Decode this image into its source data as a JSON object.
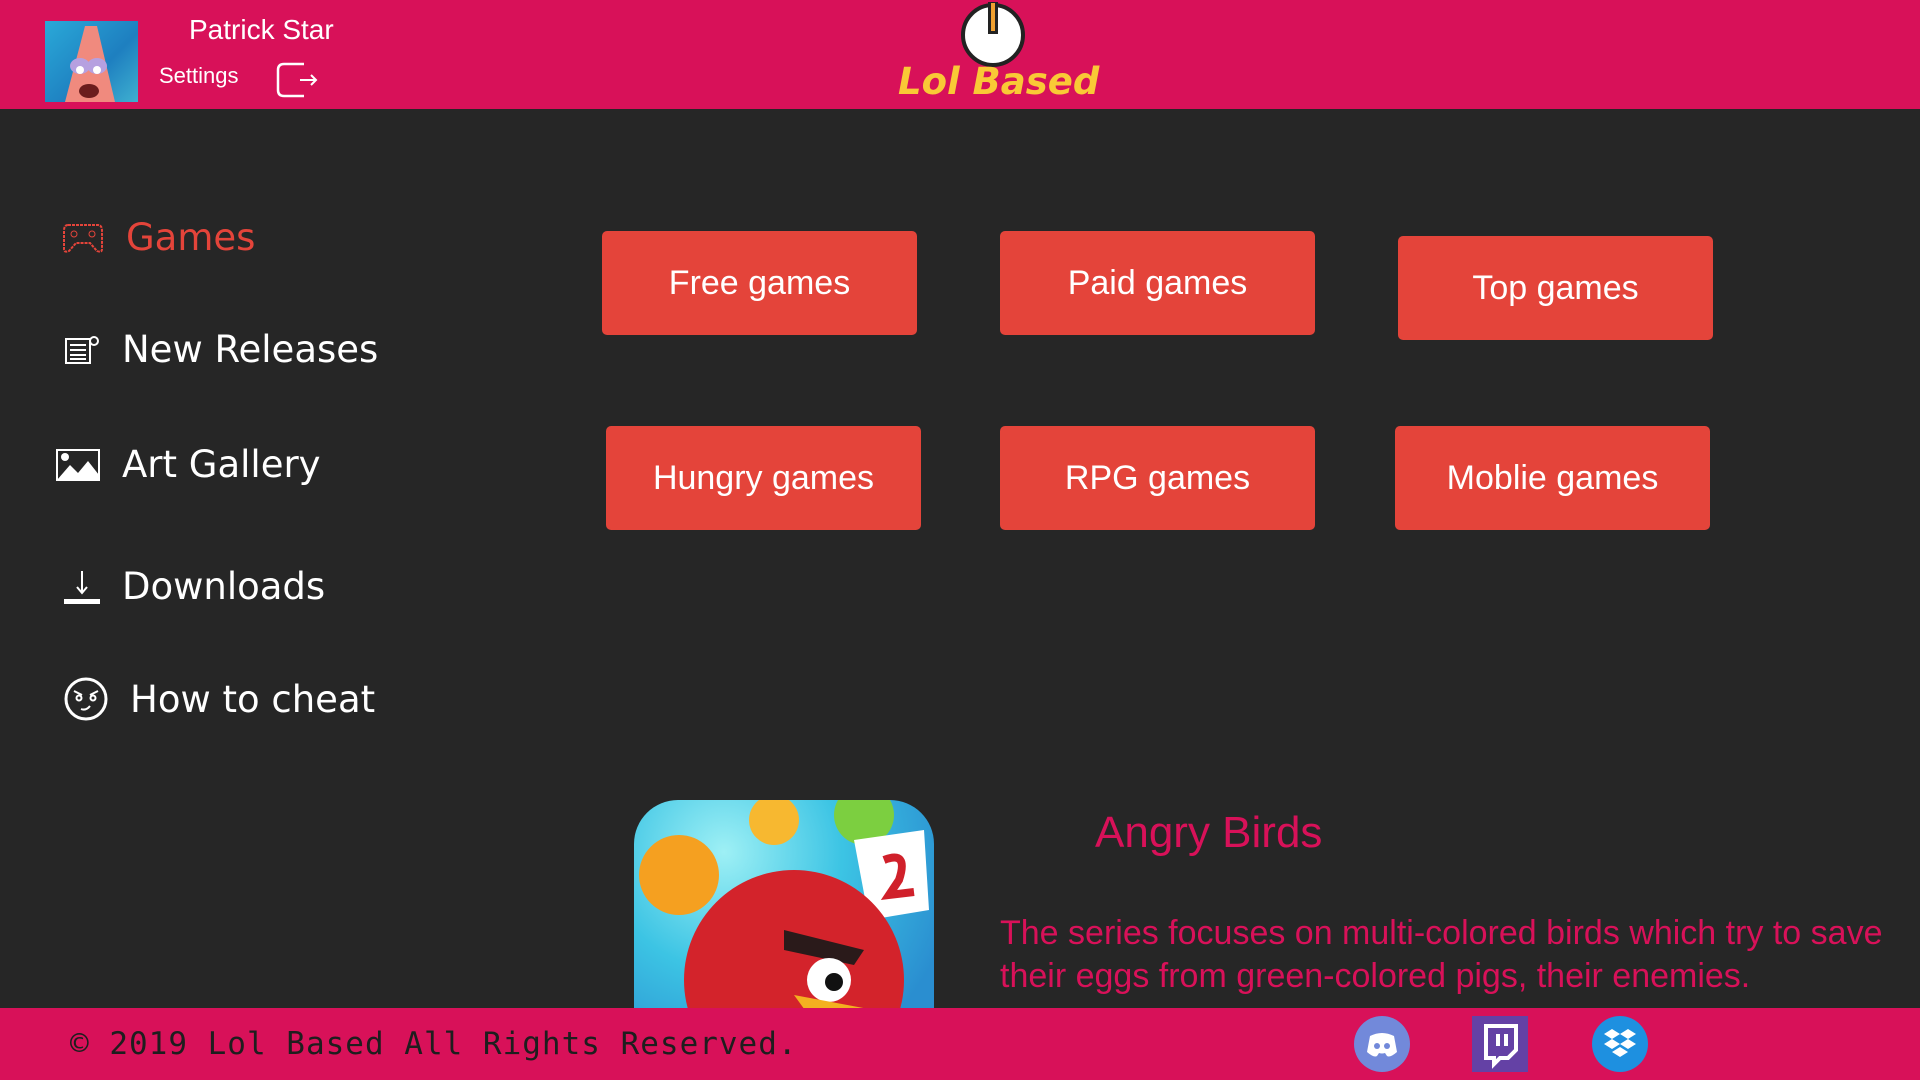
{
  "header": {
    "user_name": "Patrick Star",
    "settings_label": "Settings",
    "brand": "Lol Based"
  },
  "sidebar": {
    "items": [
      {
        "label": "Games",
        "icon": "gamepad-icon",
        "active": true
      },
      {
        "label": "New Releases",
        "icon": "news-icon"
      },
      {
        "label": "Art Gallery",
        "icon": "image-icon"
      },
      {
        "label": "Downloads",
        "icon": "download-icon"
      },
      {
        "label": "How to cheat",
        "icon": "devil-face-icon"
      }
    ]
  },
  "categories": [
    "Free games",
    "Paid games",
    "Top games",
    "Hungry games",
    "RPG games",
    "Moblie games"
  ],
  "featured": {
    "title": "Angry Birds",
    "description": "The series focuses on multi-colored birds which try to save their eggs from green-colored pigs, their enemies."
  },
  "footer": {
    "copyright": "© 2019 Lol Based All Rights Reserved.",
    "social": [
      "discord-icon",
      "twitch-icon",
      "dropbox-icon"
    ]
  },
  "colors": {
    "header": "#d81159",
    "background": "#262626",
    "button": "#e4443a",
    "brand": "#f9c936"
  }
}
